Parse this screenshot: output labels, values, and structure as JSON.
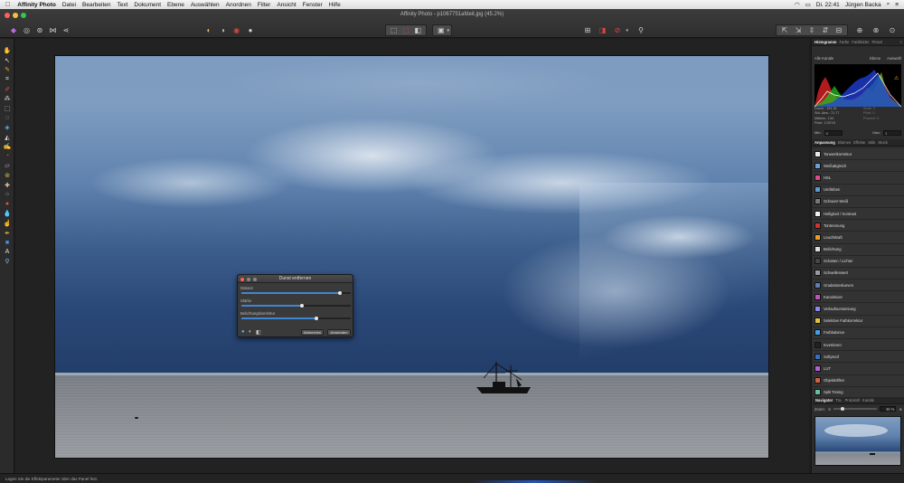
{
  "menubar": {
    "apple": "",
    "app_name": "Affinity Photo",
    "items": [
      "Datei",
      "Bearbeiten",
      "Text",
      "Dokument",
      "Ebene",
      "Auswählen",
      "Anordnen",
      "Filter",
      "Ansicht",
      "Fenster",
      "Hilfe"
    ],
    "clock": "Di. 22:41",
    "user": "Jürgen Backa"
  },
  "window": {
    "title": "Affinity Photo - p1067751afdeit.jpg (45.2%)"
  },
  "dialog": {
    "title": "Dunst entfernen",
    "params": [
      {
        "label": "Distanz",
        "value": 0.9
      },
      {
        "label": "Stärke",
        "value": 0.55
      },
      {
        "label": "Belichtungskorrektur",
        "value": 0.69
      }
    ],
    "cancel_label": "Abbrechen",
    "apply_label": "Anwenden"
  },
  "histogram_panel": {
    "tabs": [
      "Histogramm",
      "Farbe",
      "Farbfelder",
      "Pinsel"
    ],
    "channel": "Alle Kanäle",
    "layer_label": "Ebene",
    "selection_label": "Auswahl",
    "stats_left": [
      "Durch.: 151.51",
      "Std. Abw.: 71.77",
      "Mittelw.: 134",
      "Pixel: 176715"
    ],
    "stats_right": [
      "Stufe: 0",
      "Pixel: 0",
      "Prozent: 0"
    ],
    "min_label": "Min:",
    "min_value": "0",
    "max_label": "Max:",
    "max_value": "1"
  },
  "adjust_panel": {
    "tabs": [
      "Anpassung",
      "Ebenen",
      "Effekte",
      "Stile",
      "Stock"
    ],
    "items": [
      {
        "label": "Tonwertkorrektur",
        "color": "#e8e8e8"
      },
      {
        "label": "Weißabgleich",
        "color": "#6aa0d8"
      },
      {
        "label": "HSL",
        "color": "#d84a8a"
      },
      {
        "label": "Umfärben",
        "color": "#5a9ad0"
      },
      {
        "label": "Schwarz-Weiß",
        "color": "#777777"
      },
      {
        "label": "Helligkeit / Kontrast",
        "color": "#eeeeee"
      },
      {
        "label": "Tontrennung",
        "color": "#d03030"
      },
      {
        "label": "Leuchtkraft",
        "color": "#e8a020"
      },
      {
        "label": "Belichtung",
        "color": "#dddddd"
      },
      {
        "label": "Schatten / Lichter",
        "color": "#444444"
      },
      {
        "label": "Schwellenwert",
        "color": "#999999"
      },
      {
        "label": "Gradationskurven",
        "color": "#5a7fb0"
      },
      {
        "label": "Kanalmixer",
        "color": "#c050c0"
      },
      {
        "label": "Verlaufsumsetzung",
        "color": "#8888ee"
      },
      {
        "label": "Selektive Farbkorrektur",
        "color": "#e0c040"
      },
      {
        "label": "Farbbalance",
        "color": "#40a0e0"
      },
      {
        "label": "Invertieren",
        "color": "#222222"
      },
      {
        "label": "Softproof",
        "color": "#3070c0"
      },
      {
        "label": "LUT",
        "color": "#b060d0"
      },
      {
        "label": "Objektivfilter",
        "color": "#d06040"
      },
      {
        "label": "Split Toning",
        "color": "#60c0a0"
      }
    ]
  },
  "navigator": {
    "tabs": [
      "Navigator",
      "Tra.",
      "Protokoll",
      "Kanäle"
    ],
    "zoom_label": "Zoom:",
    "zoom_value": "45 %"
  },
  "statusbar": {
    "text": "Legen Sie die Effektparameter über das Panel fest."
  }
}
